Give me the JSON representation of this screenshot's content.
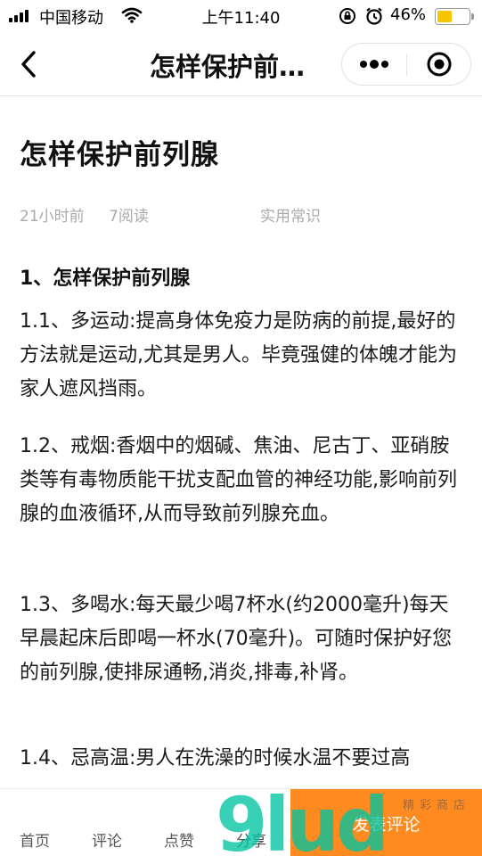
{
  "status_bar": {
    "carrier": "中国移动",
    "time": "上午11:40",
    "battery_percent": "46%",
    "battery_level": 0.46,
    "battery_color": "#f7c600"
  },
  "nav": {
    "back_icon": "chevron-left-icon",
    "title": "怎样保护前…",
    "more_icon": "more-dots-icon",
    "close_icon": "target-close-icon"
  },
  "article": {
    "title": "怎样保护前列腺",
    "meta": {
      "time_ago": "21小时前",
      "reads": "7阅读",
      "category": "实用常识"
    },
    "section_heading": "1、怎样保护前列腺",
    "paragraphs": [
      "1.1、多运动:提高身体免疫力是防病的前提,最好的方法就是运动,尤其是男人。毕竟强健的体魄才能为家人遮风挡雨。",
      "1.2、戒烟:香烟中的烟碱、焦油、尼古丁、亚硝胺类等有毒物质能干扰支配血管的神经功能,影响前列腺的血液循环,从而导致前列腺充血。",
      "1.3、多喝水:每天最少喝7杯水(约2000毫升)每天早晨起床后即喝一杯水(70毫升)。可随时保护好您的前列腺,使排尿通畅,消炎,排毒,补肾。",
      "1.4、忌高温:男人在洗澡的时候水温不要过高"
    ]
  },
  "bottom_bar": {
    "tabs": [
      "首页",
      "评论",
      "点赞",
      "分享"
    ],
    "publish_label": "发表评论",
    "publish_color": "#ff8a1f"
  },
  "watermark": {
    "text": "9lud",
    "subtext": "精彩商店"
  }
}
